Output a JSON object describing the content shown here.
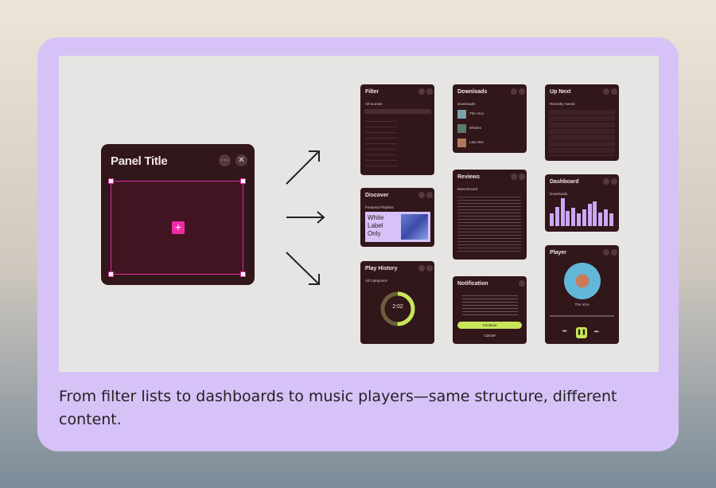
{
  "caption": "From filter lists to dashboards to music players—same structure, different content.",
  "big_panel": {
    "title": "Panel Title",
    "more_icon": "ellipsis-icon",
    "close_icon": "close-icon",
    "add_icon": "plus-icon"
  },
  "panels": {
    "filter": {
      "title": "Filter",
      "subtitle": "All Sounds"
    },
    "discover": {
      "title": "Discover",
      "subtitle": "Featured Playlists",
      "card_text": "White Label Only"
    },
    "play_history": {
      "title": "Play History",
      "subtitle": "All Categories",
      "time": "2:02"
    },
    "downloads": {
      "title": "Downloads",
      "subtitle": "Downloads",
      "items": [
        "The Vrox",
        "Wholes",
        "Last Hen"
      ]
    },
    "reviews": {
      "title": "Reviews",
      "subtitle": "Most Recent"
    },
    "notification": {
      "title": "Notification",
      "primary": "Continue",
      "secondary": "Cancel"
    },
    "up_next": {
      "title": "Up Next",
      "subtitle": "Recently Saved"
    },
    "dashboard": {
      "title": "Dashboard",
      "subtitle": "Downloads"
    },
    "player": {
      "title": "Player",
      "track": "The Vrox"
    }
  },
  "colors": {
    "panel": "#31161a",
    "accent": "#c8e65a",
    "chart": "#c9a8f4",
    "select": "#e02a9f",
    "card": "#d6c2f7"
  },
  "chart_bars": [
    0.45,
    0.7,
    1.0,
    0.55,
    0.65,
    0.45,
    0.6,
    0.8,
    0.9,
    0.5,
    0.6,
    0.45
  ]
}
